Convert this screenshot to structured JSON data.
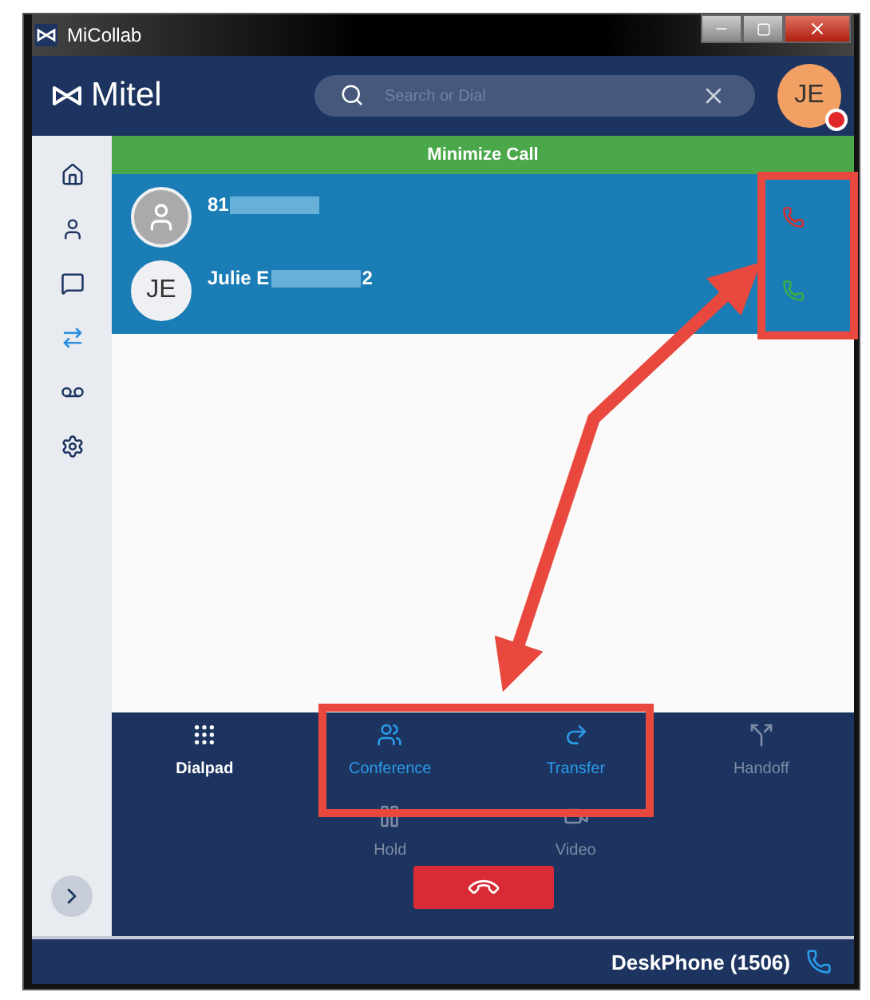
{
  "window": {
    "title": "MiCollab"
  },
  "header": {
    "brand": "Mitel",
    "search": {
      "placeholder": "Search or Dial"
    },
    "avatar": {
      "initials": "JE",
      "busy": true
    }
  },
  "sidebar": {
    "items": [
      {
        "kind": "home",
        "selected": false
      },
      {
        "kind": "contacts",
        "selected": false
      },
      {
        "kind": "chat",
        "selected": false
      },
      {
        "kind": "calls",
        "selected": true
      },
      {
        "kind": "voicemail",
        "selected": false
      },
      {
        "kind": "settings",
        "selected": false
      }
    ]
  },
  "banner": {
    "label": "Minimize Call"
  },
  "calls": [
    {
      "avatar": {
        "kind": "silhouette"
      },
      "name_parts": [
        "81"
      ],
      "on_hold": true
    },
    {
      "avatar": {
        "kind": "initials",
        "initials": "JE"
      },
      "name_parts": [
        "Julie E",
        "2"
      ],
      "on_hold": false
    }
  ],
  "actions": [
    {
      "kind": "dialpad",
      "label": "Dialpad",
      "enabled": true,
      "highlighted": false
    },
    {
      "kind": "conference",
      "label": "Conference",
      "enabled": true,
      "highlighted": true
    },
    {
      "kind": "transfer",
      "label": "Transfer",
      "enabled": true,
      "highlighted": true
    },
    {
      "kind": "handoff",
      "label": "Handoff",
      "enabled": false,
      "highlighted": false
    },
    {
      "kind": "hold",
      "label": "Hold",
      "enabled": false,
      "highlighted": false
    },
    {
      "kind": "video",
      "label": "Video",
      "enabled": false,
      "highlighted": false
    }
  ],
  "status_bar": {
    "device": "DeskPhone (1506)"
  }
}
